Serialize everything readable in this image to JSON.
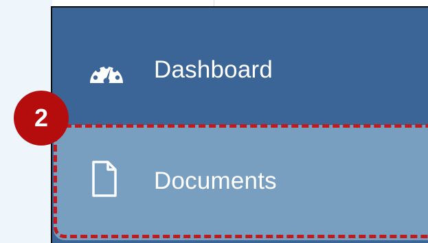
{
  "sidebar": {
    "items": [
      {
        "label": "Dashboard",
        "icon": "dashboard-gauge-icon",
        "active": false
      },
      {
        "label": "Documents",
        "icon": "document-icon",
        "active": true
      }
    ]
  },
  "annotation": {
    "step_number": "2"
  },
  "colors": {
    "sidebar_bg": "#3b6597",
    "active_item_bg": "#789fc0",
    "highlight_border": "#c21a1a",
    "badge_bg": "#b50d0d",
    "page_bg": "#eef5fb"
  }
}
